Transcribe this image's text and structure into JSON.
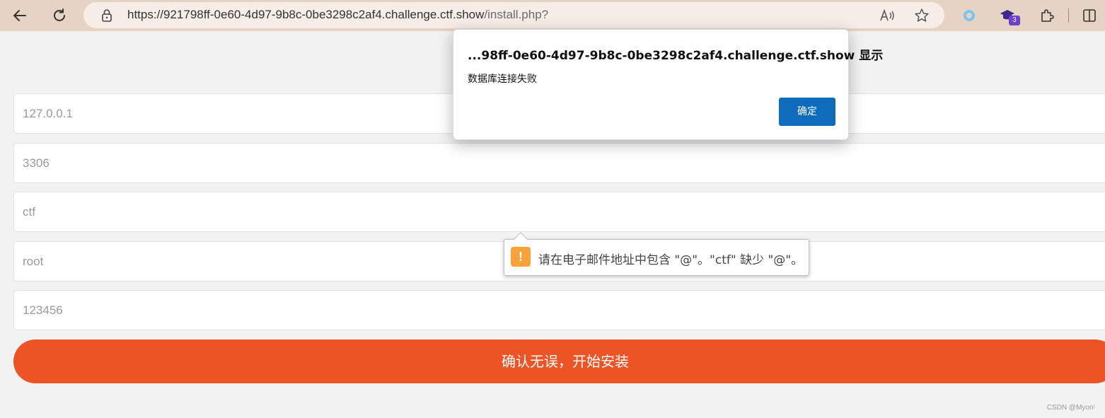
{
  "browser": {
    "url_host": "https://921798ff-0e60-4d97-9b8c-0be3298c2af4.challenge.ctf.show",
    "url_path": "/install.php?",
    "extension_badge": "3",
    "icons": [
      "back-icon",
      "refresh-icon",
      "lock-icon",
      "read-aloud-icon",
      "favorite-star-icon",
      "circle-extension-icon",
      "graduation-cap-icon",
      "extensions-icon",
      "split-screen-icon"
    ]
  },
  "form": {
    "fields": [
      {
        "name": "db_host",
        "value": "127.0.0.1"
      },
      {
        "name": "db_port",
        "value": "3306"
      },
      {
        "name": "db_name",
        "value": "ctf"
      },
      {
        "name": "db_user",
        "value": "root"
      },
      {
        "name": "db_pass",
        "value": "123456"
      }
    ],
    "submit_label": "确认无误，开始安装"
  },
  "validation_tooltip": {
    "message": "请在电子邮件地址中包含 \"@\"。\"ctf\" 缺少 \"@\"。",
    "icon": "warning-icon",
    "icon_glyph": "!"
  },
  "alert_dialog": {
    "title": "...98ff-0e60-4d97-9b8c-0be3298c2af4.challenge.ctf.show 显示",
    "message": "数据库连接失败",
    "ok_label": "确定",
    "ok_color": "#0f6cbd"
  },
  "watermark": "CSDN @Myon⁽"
}
